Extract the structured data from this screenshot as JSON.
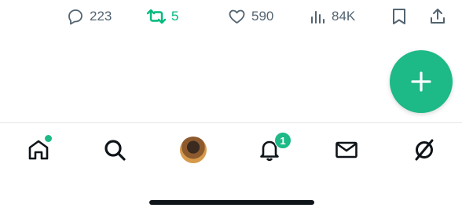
{
  "tweet_actions": {
    "reply_count": "223",
    "retweet_count": "5",
    "like_count": "590",
    "views_count": "84K"
  },
  "colors": {
    "accent": "#1db987",
    "retweet_active": "#00ba7c",
    "icon_gray": "#536471",
    "icon_dark": "#0f1419"
  },
  "fab": {
    "icon": "plus-icon"
  },
  "bottom_nav": {
    "items": [
      {
        "name": "home",
        "icon": "home-icon",
        "has_dot": true
      },
      {
        "name": "search",
        "icon": "search-icon"
      },
      {
        "name": "communities",
        "icon": "avatar"
      },
      {
        "name": "notifications",
        "icon": "bell-icon",
        "badge": "1"
      },
      {
        "name": "messages",
        "icon": "mail-icon"
      },
      {
        "name": "grok",
        "icon": "grok-icon"
      }
    ]
  }
}
